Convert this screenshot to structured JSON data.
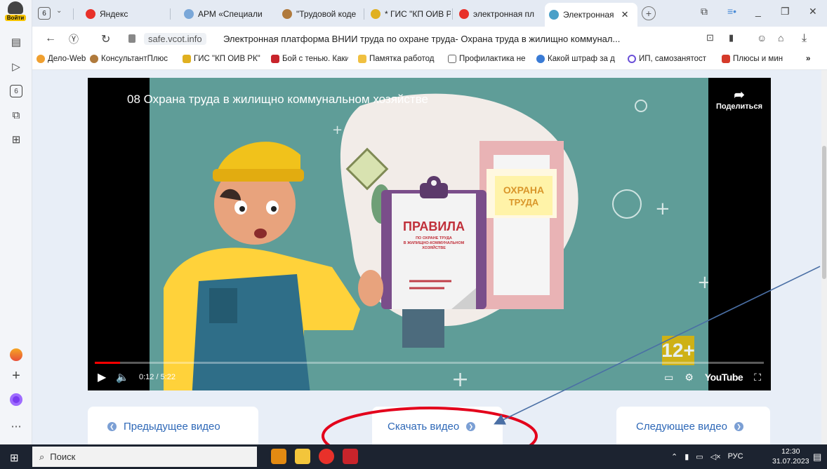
{
  "login": {
    "label": "Войти"
  },
  "tabs": {
    "count": "6",
    "items": [
      {
        "label": "Яндекс"
      },
      {
        "label": "АРМ «Специали"
      },
      {
        "label": "\"Трудовой коде"
      },
      {
        "label": "* ГИС \"КП ОИВ Р"
      },
      {
        "label": "электронная пл"
      },
      {
        "label": "Электронная"
      }
    ]
  },
  "sidebar": {
    "tab_count": "6"
  },
  "address": {
    "host": "safe.vcot.info",
    "title": "Электронная платформа ВНИИ труда по охране труда- Охрана труда в жилищно коммунал..."
  },
  "bookmarks": [
    {
      "label": "Дело-Web"
    },
    {
      "label": "КонсультантПлюс"
    },
    {
      "label": "ГИС \"КП ОИВ РК\""
    },
    {
      "label": "Бой с тенью. Каки"
    },
    {
      "label": "Памятка работод"
    },
    {
      "label": "Профилактика не"
    },
    {
      "label": "Какой штраф за д"
    },
    {
      "label": "ИП, самозанятост"
    },
    {
      "label": "Плюсы и мин"
    }
  ],
  "video": {
    "title": "08 Охрана труда в жилищно коммунальном хозяйстве",
    "share_label": "Поделиться",
    "time": "0:12 / 5:22",
    "progress_fraction": 0.038,
    "brand": "YouTube",
    "age_rating": "12+",
    "scene": {
      "sign_title": "ПРАВИЛА",
      "sign_sub1": "ПО ОХРАНЕ ТРУДА",
      "sign_sub2": "В ЖИЛИЩНО-КОММУНАЛЬНОМ",
      "sign_sub3": "ХОЗЯЙСТВЕ",
      "poster_line1": "ОХРАНА",
      "poster_line2": "ТРУДА"
    }
  },
  "nav": {
    "prev_label": "Предыдущее видео",
    "download_label": "Скачать видео",
    "next_label": "Следующее видео"
  },
  "taskbar": {
    "search_placeholder": "Поиск",
    "lang": "РУС",
    "time": "12:30",
    "date": "31.07.2023"
  },
  "colors": {
    "accent": "#2e68b7",
    "annotation_red": "#e3001b",
    "annotation_arrow": "#4a6fa5",
    "scene_teal": "#5f9d98"
  }
}
